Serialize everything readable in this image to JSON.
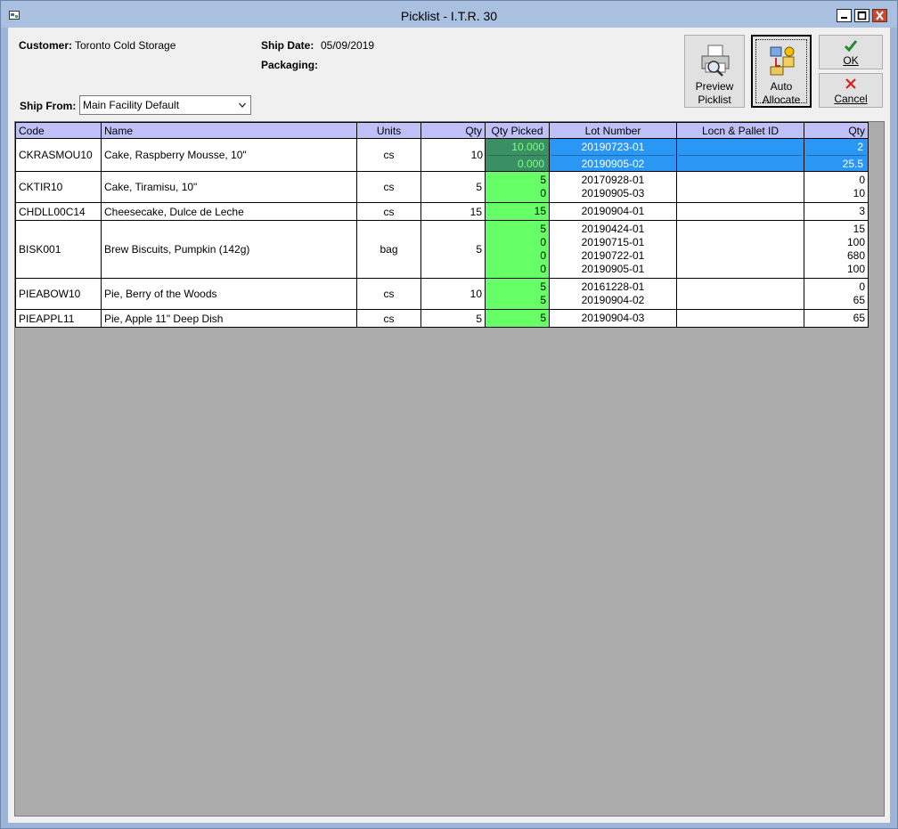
{
  "window": {
    "title": "Picklist - I.T.R. 30"
  },
  "header": {
    "customer_label": "Customer:",
    "customer_value": "Toronto Cold Storage",
    "ship_date_label": "Ship Date:",
    "ship_date_value": "05/09/2019",
    "packaging_label": "Packaging:",
    "ship_from_label": "Ship From:",
    "ship_from_value": "Main Facility Default"
  },
  "toolbar": {
    "preview_line1": "Preview",
    "preview_line2": "Picklist",
    "auto_line1": "Auto",
    "auto_line2": "Allocate",
    "ok_label": "OK",
    "cancel_label": "Cancel"
  },
  "grid": {
    "columns": [
      "Code",
      "Name",
      "Units",
      "Qty",
      "Qty Picked",
      "Lot Number",
      "Locn & Pallet ID",
      "Qty"
    ],
    "rows": [
      {
        "code": "CKRASMOU10",
        "name": "Cake, Raspberry Mousse, 10\"",
        "units": "cs",
        "qty": "10",
        "picked": [
          "10.000",
          "0.000"
        ],
        "lots": [
          "20190723-01",
          "20190905-02"
        ],
        "locn": [
          "",
          ""
        ],
        "lot_qty": [
          "2",
          "25.5"
        ],
        "selected": true
      },
      {
        "code": "CKTIR10",
        "name": "Cake, Tiramisu, 10\"",
        "units": "cs",
        "qty": "5",
        "picked": [
          "5",
          "0"
        ],
        "lots": [
          "20170928-01",
          "20190905-03"
        ],
        "locn": [
          "",
          ""
        ],
        "lot_qty": [
          "0",
          "10"
        ]
      },
      {
        "code": "CHDLL00C14",
        "name": "Cheesecake, Dulce de Leche",
        "units": "cs",
        "qty": "15",
        "picked": [
          "15"
        ],
        "lots": [
          "20190904-01"
        ],
        "locn": [
          ""
        ],
        "lot_qty": [
          "3"
        ]
      },
      {
        "code": "BISK001",
        "name": "Brew Biscuits, Pumpkin (142g)",
        "units": "bag",
        "qty": "5",
        "picked": [
          "5",
          "0",
          "0",
          "0"
        ],
        "lots": [
          "20190424-01",
          "20190715-01",
          "20190722-01",
          "20190905-01"
        ],
        "locn": [
          "",
          "",
          "",
          ""
        ],
        "lot_qty": [
          "15",
          "100",
          "680",
          "100"
        ]
      },
      {
        "code": "PIEABOW10",
        "name": "Pie, Berry of the Woods",
        "units": "cs",
        "qty": "10",
        "picked": [
          "5",
          "5"
        ],
        "lots": [
          "20161228-01",
          "20190904-02"
        ],
        "locn": [
          "",
          ""
        ],
        "lot_qty": [
          "0",
          "65"
        ]
      },
      {
        "code": "PIEAPPL11",
        "name": "Pie, Apple 11\" Deep Dish",
        "units": "cs",
        "qty": "5",
        "picked": [
          "5"
        ],
        "lots": [
          "20190904-03"
        ],
        "locn": [
          ""
        ],
        "lot_qty": [
          "65"
        ]
      }
    ]
  },
  "icons": {
    "app": "app-icon",
    "minimize": "minimize-icon",
    "maximize": "maximize-icon",
    "close": "close-icon",
    "preview": "printer-icon",
    "auto": "auto-allocate-icon",
    "ok": "checkmark-icon",
    "cancel": "x-icon"
  },
  "colors": {
    "header_bg": "#c0c0f8",
    "picked_bg": "#66ff66",
    "selected_blue": "#2a97f5",
    "selected_picked": "#3a8f64",
    "grid_empty": "#ababab"
  }
}
